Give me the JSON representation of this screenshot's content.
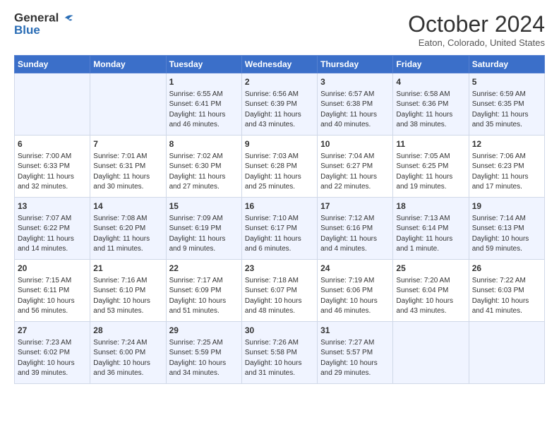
{
  "header": {
    "logo_line1": "General",
    "logo_line2": "Blue",
    "month": "October 2024",
    "location": "Eaton, Colorado, United States"
  },
  "weekdays": [
    "Sunday",
    "Monday",
    "Tuesday",
    "Wednesday",
    "Thursday",
    "Friday",
    "Saturday"
  ],
  "weeks": [
    [
      {
        "day": "",
        "info": ""
      },
      {
        "day": "",
        "info": ""
      },
      {
        "day": "1",
        "info": "Sunrise: 6:55 AM\nSunset: 6:41 PM\nDaylight: 11 hours and 46 minutes."
      },
      {
        "day": "2",
        "info": "Sunrise: 6:56 AM\nSunset: 6:39 PM\nDaylight: 11 hours and 43 minutes."
      },
      {
        "day": "3",
        "info": "Sunrise: 6:57 AM\nSunset: 6:38 PM\nDaylight: 11 hours and 40 minutes."
      },
      {
        "day": "4",
        "info": "Sunrise: 6:58 AM\nSunset: 6:36 PM\nDaylight: 11 hours and 38 minutes."
      },
      {
        "day": "5",
        "info": "Sunrise: 6:59 AM\nSunset: 6:35 PM\nDaylight: 11 hours and 35 minutes."
      }
    ],
    [
      {
        "day": "6",
        "info": "Sunrise: 7:00 AM\nSunset: 6:33 PM\nDaylight: 11 hours and 32 minutes."
      },
      {
        "day": "7",
        "info": "Sunrise: 7:01 AM\nSunset: 6:31 PM\nDaylight: 11 hours and 30 minutes."
      },
      {
        "day": "8",
        "info": "Sunrise: 7:02 AM\nSunset: 6:30 PM\nDaylight: 11 hours and 27 minutes."
      },
      {
        "day": "9",
        "info": "Sunrise: 7:03 AM\nSunset: 6:28 PM\nDaylight: 11 hours and 25 minutes."
      },
      {
        "day": "10",
        "info": "Sunrise: 7:04 AM\nSunset: 6:27 PM\nDaylight: 11 hours and 22 minutes."
      },
      {
        "day": "11",
        "info": "Sunrise: 7:05 AM\nSunset: 6:25 PM\nDaylight: 11 hours and 19 minutes."
      },
      {
        "day": "12",
        "info": "Sunrise: 7:06 AM\nSunset: 6:23 PM\nDaylight: 11 hours and 17 minutes."
      }
    ],
    [
      {
        "day": "13",
        "info": "Sunrise: 7:07 AM\nSunset: 6:22 PM\nDaylight: 11 hours and 14 minutes."
      },
      {
        "day": "14",
        "info": "Sunrise: 7:08 AM\nSunset: 6:20 PM\nDaylight: 11 hours and 11 minutes."
      },
      {
        "day": "15",
        "info": "Sunrise: 7:09 AM\nSunset: 6:19 PM\nDaylight: 11 hours and 9 minutes."
      },
      {
        "day": "16",
        "info": "Sunrise: 7:10 AM\nSunset: 6:17 PM\nDaylight: 11 hours and 6 minutes."
      },
      {
        "day": "17",
        "info": "Sunrise: 7:12 AM\nSunset: 6:16 PM\nDaylight: 11 hours and 4 minutes."
      },
      {
        "day": "18",
        "info": "Sunrise: 7:13 AM\nSunset: 6:14 PM\nDaylight: 11 hours and 1 minute."
      },
      {
        "day": "19",
        "info": "Sunrise: 7:14 AM\nSunset: 6:13 PM\nDaylight: 10 hours and 59 minutes."
      }
    ],
    [
      {
        "day": "20",
        "info": "Sunrise: 7:15 AM\nSunset: 6:11 PM\nDaylight: 10 hours and 56 minutes."
      },
      {
        "day": "21",
        "info": "Sunrise: 7:16 AM\nSunset: 6:10 PM\nDaylight: 10 hours and 53 minutes."
      },
      {
        "day": "22",
        "info": "Sunrise: 7:17 AM\nSunset: 6:09 PM\nDaylight: 10 hours and 51 minutes."
      },
      {
        "day": "23",
        "info": "Sunrise: 7:18 AM\nSunset: 6:07 PM\nDaylight: 10 hours and 48 minutes."
      },
      {
        "day": "24",
        "info": "Sunrise: 7:19 AM\nSunset: 6:06 PM\nDaylight: 10 hours and 46 minutes."
      },
      {
        "day": "25",
        "info": "Sunrise: 7:20 AM\nSunset: 6:04 PM\nDaylight: 10 hours and 43 minutes."
      },
      {
        "day": "26",
        "info": "Sunrise: 7:22 AM\nSunset: 6:03 PM\nDaylight: 10 hours and 41 minutes."
      }
    ],
    [
      {
        "day": "27",
        "info": "Sunrise: 7:23 AM\nSunset: 6:02 PM\nDaylight: 10 hours and 39 minutes."
      },
      {
        "day": "28",
        "info": "Sunrise: 7:24 AM\nSunset: 6:00 PM\nDaylight: 10 hours and 36 minutes."
      },
      {
        "day": "29",
        "info": "Sunrise: 7:25 AM\nSunset: 5:59 PM\nDaylight: 10 hours and 34 minutes."
      },
      {
        "day": "30",
        "info": "Sunrise: 7:26 AM\nSunset: 5:58 PM\nDaylight: 10 hours and 31 minutes."
      },
      {
        "day": "31",
        "info": "Sunrise: 7:27 AM\nSunset: 5:57 PM\nDaylight: 10 hours and 29 minutes."
      },
      {
        "day": "",
        "info": ""
      },
      {
        "day": "",
        "info": ""
      }
    ]
  ]
}
